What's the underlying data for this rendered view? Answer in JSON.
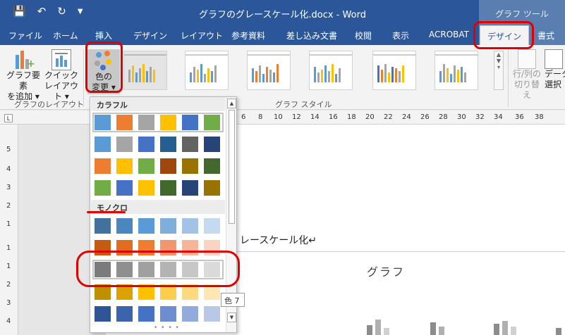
{
  "titlebar": {
    "save_icon": "save-icon",
    "undo_icon": "undo-icon",
    "redo_icon": "redo-icon",
    "customize_icon": "customize-qat-icon",
    "title": "グラフのグレースケール化.docx - Word",
    "context_header": "グラフ ツール"
  },
  "tabs": [
    "ファイル",
    "ホーム",
    "挿入",
    "デザイン",
    "レイアウト",
    "参考資料",
    "差し込み文書",
    "校閲",
    "表示",
    "ACROBAT",
    "デザイン",
    "書式"
  ],
  "ribbon": {
    "add_element": {
      "line1": "グラフ要素",
      "line2": "を追加 ▾"
    },
    "quick_layout": {
      "line1": "クイック",
      "line2": "レイアウト ▾"
    },
    "change_color": {
      "line1": "色の",
      "line2": "変更 ▾"
    },
    "group_layout": "グラフのレイアウト",
    "group_styles": "グラフ スタイル",
    "switch_rowcol": {
      "line1": "行/列の",
      "line2": "切り替え"
    },
    "select_data": {
      "line1": "データ",
      "line2": "選択"
    }
  },
  "ruler": [
    "6",
    "8",
    "10",
    "12",
    "14",
    "16",
    "18",
    "20",
    "22",
    "24",
    "26",
    "28",
    "30",
    "32",
    "34",
    "36",
    "38"
  ],
  "ruler_v": [
    "5",
    "4",
    "3",
    "2",
    "1",
    "1",
    "1",
    "2",
    "3",
    "4"
  ],
  "document": {
    "text": "レースケール化↵",
    "chart_title": "グラフ"
  },
  "color_dropdown": {
    "colorful_header": "カラフル",
    "mono_header": "モノクロ",
    "colorful_rows": [
      [
        "#5b9bd5",
        "#ed7d31",
        "#a5a5a5",
        "#ffc000",
        "#4472c4",
        "#70ad47"
      ],
      [
        "#5b9bd5",
        "#a5a5a5",
        "#4472c4",
        "#255e91",
        "#636363",
        "#264478"
      ],
      [
        "#ed7d31",
        "#ffc000",
        "#70ad47",
        "#9e480e",
        "#997300",
        "#43682b"
      ],
      [
        "#70ad47",
        "#4472c4",
        "#ffc000",
        "#43682b",
        "#264478",
        "#997300"
      ]
    ],
    "mono_rows": [
      [
        "#41719c",
        "#4a86c0",
        "#5b9bd5",
        "#7eaedc",
        "#a2c3e6",
        "#c5d9f0"
      ],
      [
        "#c55a11",
        "#e26d1e",
        "#ed7d31",
        "#f0976c",
        "#f4b697",
        "#f9d5c1"
      ],
      [
        "#7b7b7b",
        "#8f8f8f",
        "#a0a0a0",
        "#b3b3b3",
        "#c7c7c7",
        "#dadada"
      ],
      [
        "#bf8f00",
        "#dca300",
        "#ffc000",
        "#ffcd4d",
        "#ffd97f",
        "#ffe6b3"
      ],
      [
        "#2f5597",
        "#3b64ad",
        "#4472c4",
        "#6c8ed0",
        "#93abdc",
        "#bac8e8"
      ]
    ],
    "tooltip": "色 7"
  },
  "colors": {
    "brand": "#2b579a",
    "annotation": "#e00000"
  }
}
